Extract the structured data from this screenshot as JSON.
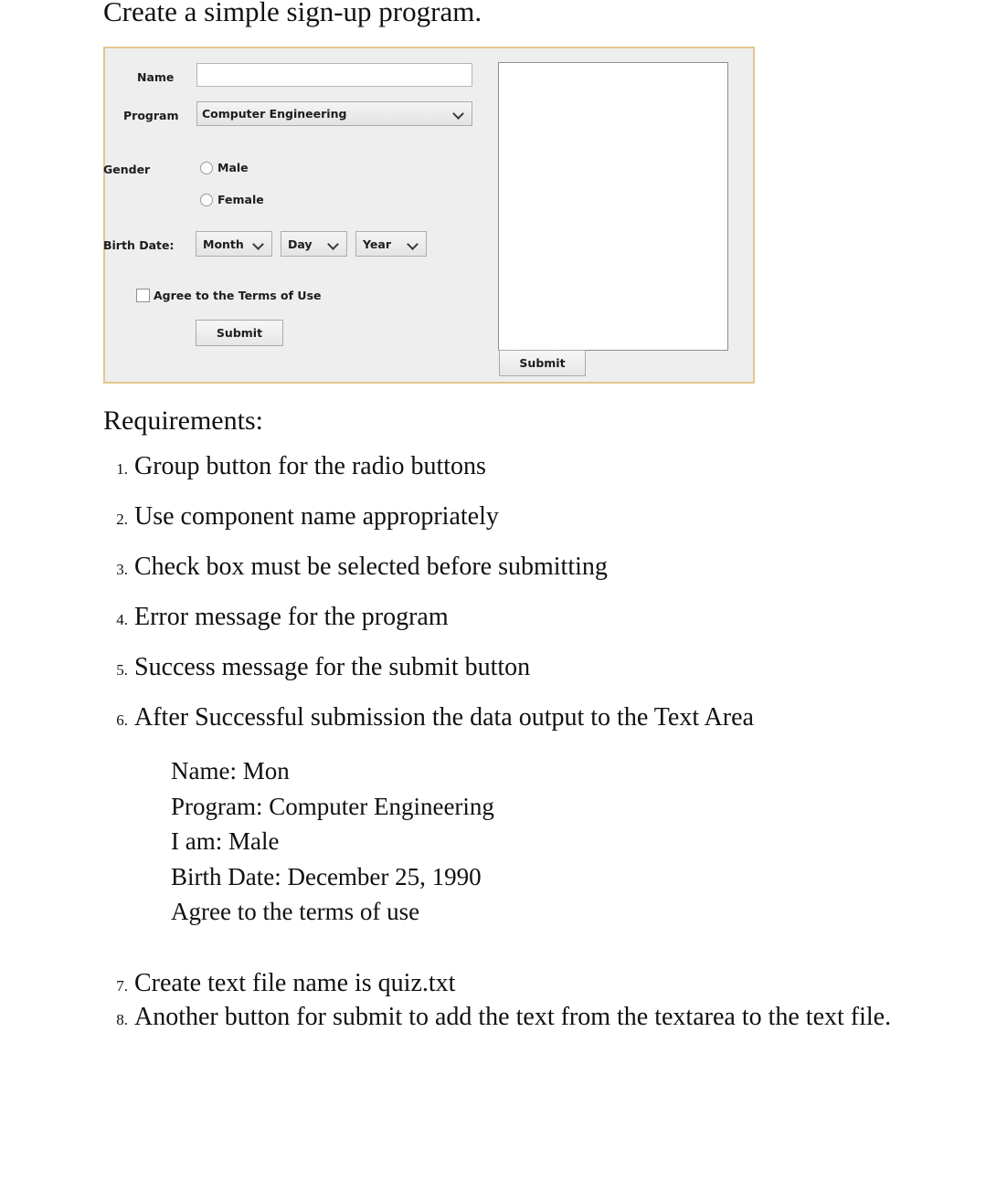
{
  "document": {
    "title": "Create a simple sign-up program.",
    "requirements_heading": "Requirements:"
  },
  "app": {
    "form": {
      "name_label": "Name",
      "name_value": "",
      "name_placeholder": "",
      "program_label": "Program",
      "program_selected": "Computer Engineering",
      "gender_label": "Gender",
      "gender_options": [
        {
          "label": "Male",
          "selected": false
        },
        {
          "label": "Female",
          "selected": false
        }
      ],
      "birth_date_label": "Birth Date:",
      "birth_month_selected": "Month",
      "birth_day_selected": "Day",
      "birth_year_selected": "Year",
      "agree_label": "Agree to the Terms of Use",
      "agree_checked": false,
      "submit_label": "Submit"
    },
    "output": {
      "textarea_value": "",
      "submit_label": "Submit"
    },
    "colors": {
      "panel_border": "#e3c58e",
      "panel_background": "#eeeeee",
      "field_background": "#ffffff"
    }
  },
  "requirements": {
    "items": [
      {
        "num": "1.",
        "text": "Group button for the radio buttons"
      },
      {
        "num": "2.",
        "text": "Use component name appropriately"
      },
      {
        "num": "3.",
        "text": "Check box must be selected before submitting"
      },
      {
        "num": "4.",
        "text": "Error message for the program"
      },
      {
        "num": "5.",
        "text": "Success message for the submit button"
      },
      {
        "num": "6.",
        "text": "After Successful submission the data output to the Text Area"
      }
    ],
    "sample_output": "Name: Mon\nProgram: Computer Engineering\nI am: Male\nBirth Date: December 25, 1990\nAgree to the terms of use",
    "tail_items": [
      {
        "num": "7.",
        "text": "Create text file name is quiz.txt"
      },
      {
        "num": "8.",
        "text": "Another button for submit to add the text from the textarea to the text file."
      }
    ]
  }
}
